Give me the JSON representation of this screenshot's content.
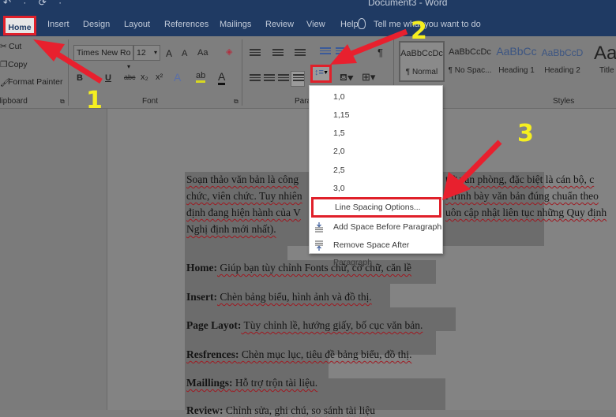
{
  "window": {
    "quick_access": "↶ · ⟳ ·",
    "title": "Document3 - Word"
  },
  "tabs": [
    {
      "label": "Home",
      "active": true
    },
    {
      "label": "Insert"
    },
    {
      "label": "Design"
    },
    {
      "label": "Layout"
    },
    {
      "label": "References"
    },
    {
      "label": "Mailings"
    },
    {
      "label": "Review"
    },
    {
      "label": "View"
    },
    {
      "label": "Help"
    }
  ],
  "tell_me": "Tell me what you want to do",
  "clipboard": {
    "cut": "Cut",
    "copy": "Copy",
    "format_painter": "Format Painter",
    "group_label": "Clipboard"
  },
  "font": {
    "font_name": "Times New Ro",
    "font_size": "12",
    "grow": "A",
    "shrink": "A",
    "change_case": "Aa",
    "bold": "B",
    "underline": "U",
    "strikethrough": "abc",
    "subscript": "x₂",
    "superscript": "x²",
    "group_label": "Font"
  },
  "paragraph": {
    "group_label": "Paragraph",
    "pilcrow": "¶"
  },
  "styles": {
    "group_label": "Styles",
    "items": [
      {
        "preview": "AaBbCcDc",
        "name": "¶ Normal"
      },
      {
        "preview": "AaBbCcDc",
        "name": "¶ No Spac..."
      },
      {
        "preview": "AaBbCc",
        "name": "Heading 1"
      },
      {
        "preview": "AaBbCcD",
        "name": "Heading 2"
      },
      {
        "preview": "Aa",
        "name": "Title"
      }
    ]
  },
  "line_spacing_menu": {
    "values": [
      "1,0",
      "1,15",
      "1,5",
      "2,0",
      "2,5",
      "3,0"
    ],
    "options": "Line Spacing Options...",
    "add_before": "Add Space Before Paragraph",
    "remove_after": "Remove Space After Paragraph"
  },
  "document": {
    "intro_lines": [
      "Soạn thảo văn bản là công",
      "chức, viên chức. Tuy nhiên",
      "định đang hiện hành của V",
      "Nghị định mới nhất)."
    ],
    "intro_right": [
      "t ở văn phòng, đặc biệt là cán bộ, c",
      "i trình bày văn bản đúng chuẩn theo",
      "uôn cập nhật liên tục những Quy định"
    ],
    "items": [
      {
        "term": "Home:",
        "desc": " Giúp bạn tùy chỉnh Fonts chữ, cỡ chữ, căn lề"
      },
      {
        "term": "Insert:",
        "desc": " Chèn bảng biểu, hình ảnh và đồ thị."
      },
      {
        "term": "Page Layot:",
        "desc": " Tùy chỉnh lề, hướng giấy, bố cục văn bản."
      },
      {
        "term": "Resfrences:",
        "desc": " Chèn mục lục, tiêu đề bảng biểu, đồ thị."
      },
      {
        "term": "Maillings:",
        "desc": " Hỗ trợ trộn tài liệu."
      },
      {
        "term": "Review:",
        "desc": " Chỉnh sửa, ghi chú, so sánh tài liệu"
      }
    ]
  },
  "annotations": {
    "step1": "1",
    "step2": "2",
    "step3": "3",
    "highlight_color": "#e0202a",
    "number_color": "#f5ef20"
  }
}
